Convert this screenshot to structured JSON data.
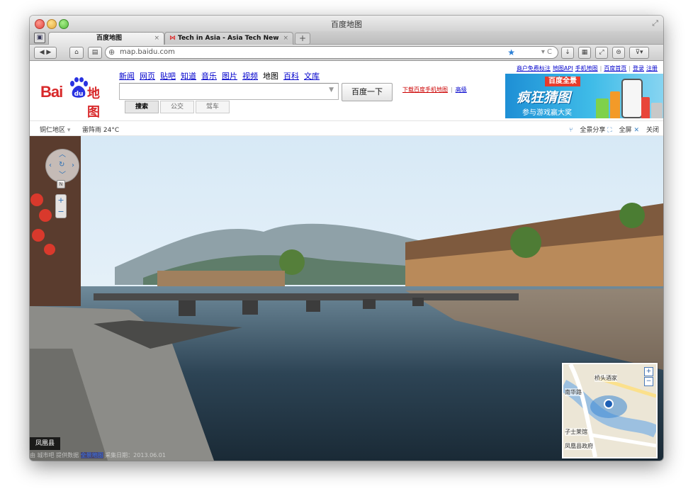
{
  "window": {
    "title": "百度地图"
  },
  "tabs": [
    {
      "label": "百度地图",
      "active": true
    },
    {
      "label": "Tech in Asia - Asia Tech News f...",
      "active": false
    }
  ],
  "toolbar": {
    "url": "map.baidu.com"
  },
  "header": {
    "logo": {
      "bai": "Bai",
      "du": "du",
      "ditu": "地图"
    },
    "nav": [
      "新闻",
      "网页",
      "贴吧",
      "知道",
      "音乐",
      "图片",
      "视频",
      "地图",
      "百科",
      "文库"
    ],
    "search_button": "百度一下",
    "search_tabs": [
      "搜索",
      "公交",
      "驾车"
    ],
    "download_link": "下载百度手机地图",
    "advanced_link": "高级",
    "top_links": [
      "商户免费标注",
      "地图API",
      "手机地图",
      "百度首页",
      "登录",
      "注册"
    ],
    "banner": {
      "tag": "百度全景",
      "title": "疯狂猜图",
      "subtitle": "参与游戏赢大奖"
    }
  },
  "subbar": {
    "city": "铜仁地区",
    "weather": "雷阵雨 24°C",
    "tools": [
      "全景分享",
      "全屏",
      "关闭"
    ]
  },
  "panorama": {
    "location_label": "凤凰县",
    "footer": {
      "prefix": "由  城市吧  提供数据  ",
      "highlight": "全景地图",
      "suffix": "  采集日期：2013.06.01"
    },
    "minimap": {
      "labels": [
        "桥头酒家",
        "子士莱馆",
        "凤凰县政府",
        "南华路"
      ]
    }
  },
  "colors": {
    "brand_red": "#d8282a",
    "link_blue": "#0000cc",
    "banner_blue": "#1e8fd5"
  }
}
